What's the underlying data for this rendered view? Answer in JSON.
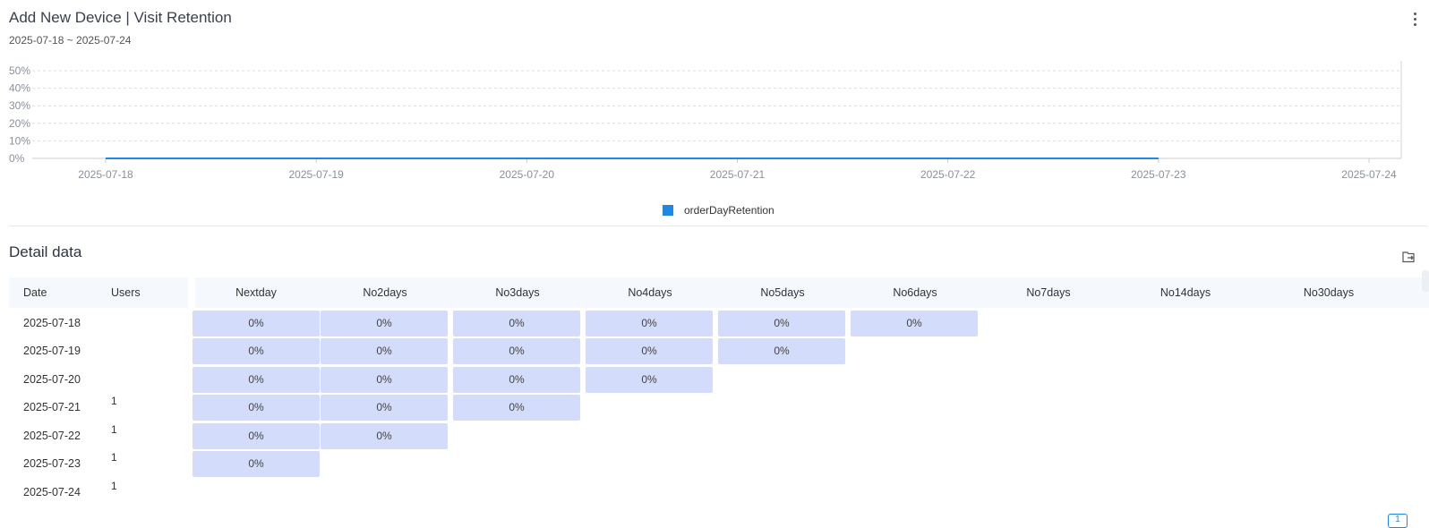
{
  "header": {
    "title": "Add New Device | Visit Retention",
    "date_range": "2025-07-18 ~ 2025-07-24"
  },
  "chart_data": {
    "type": "line",
    "x": [
      "2025-07-18",
      "2025-07-19",
      "2025-07-20",
      "2025-07-21",
      "2025-07-22",
      "2025-07-23",
      "2025-07-24"
    ],
    "series": [
      {
        "name": "orderDayRetention",
        "values": [
          0,
          0,
          0,
          0,
          0,
          0,
          null
        ],
        "color": "#1e88e5"
      }
    ],
    "y_ticks": [
      "0%",
      "10%",
      "20%",
      "30%",
      "40%",
      "50%"
    ],
    "ylim": [
      0,
      50
    ],
    "grid": true,
    "legend": "bottom-center"
  },
  "detail": {
    "title": "Detail data",
    "columns": {
      "date": "Date",
      "users": "Users",
      "retention": [
        "Nextday",
        "No2days",
        "No3days",
        "No4days",
        "No5days",
        "No6days",
        "No7days",
        "No14days",
        "No30days"
      ]
    },
    "rows": [
      {
        "date": "2025-07-18",
        "users": "",
        "values": [
          "0%",
          "0%",
          "0%",
          "0%",
          "0%",
          "0%"
        ]
      },
      {
        "date": "2025-07-19",
        "users": "",
        "values": [
          "0%",
          "0%",
          "0%",
          "0%",
          "0%"
        ]
      },
      {
        "date": "2025-07-20",
        "users": "",
        "values": [
          "0%",
          "0%",
          "0%",
          "0%"
        ]
      },
      {
        "date": "2025-07-21",
        "users": "1",
        "values": [
          "0%",
          "0%",
          "0%"
        ]
      },
      {
        "date": "2025-07-22",
        "users": "1",
        "values": [
          "0%",
          "0%"
        ]
      },
      {
        "date": "2025-07-23",
        "users": "1",
        "values": [
          "0%"
        ]
      },
      {
        "date": "2025-07-24",
        "users": "1",
        "values": []
      }
    ]
  },
  "pagination": {
    "current": "1"
  },
  "icons": {
    "more": "more-vertical-icon",
    "export": "export-icon"
  }
}
